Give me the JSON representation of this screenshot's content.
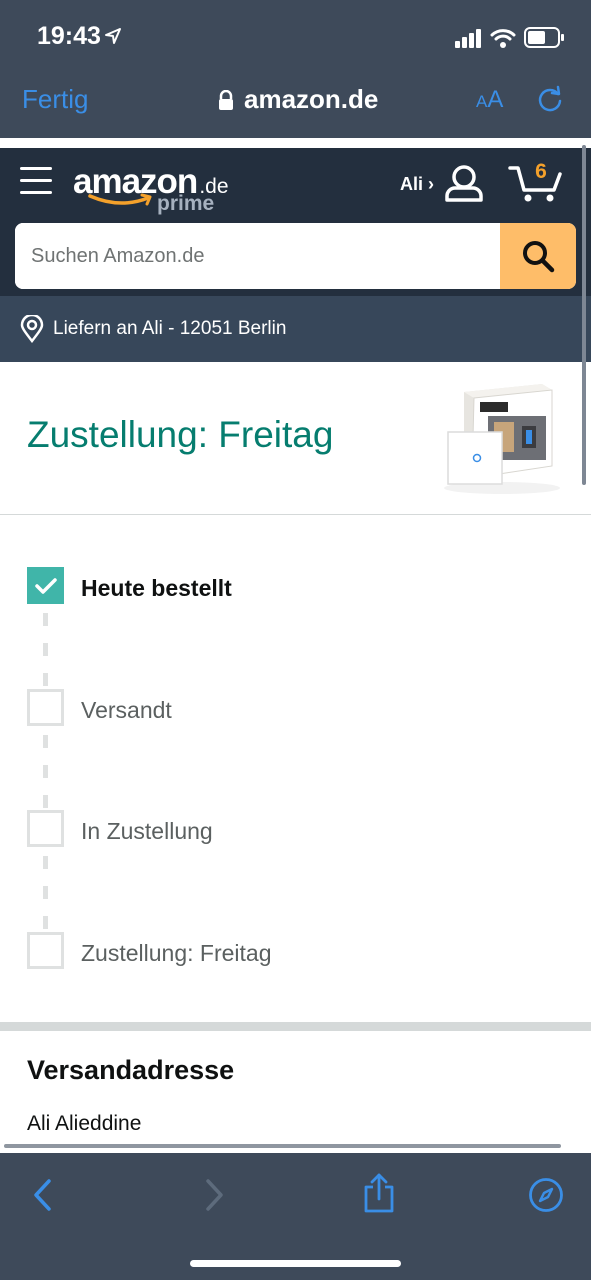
{
  "status_bar": {
    "time": "19:43"
  },
  "browser": {
    "done_label": "Fertig",
    "domain": "amazon.de",
    "text_size_small": "A",
    "text_size_large": "A"
  },
  "header": {
    "logo_main": "amazon",
    "logo_tld": ".de",
    "logo_sub": "prime",
    "account_label": "Ali ›",
    "cart_count": "6",
    "colors": {
      "header_bg": "#232f3e",
      "accent": "#febd69",
      "cart": "#f4a12b"
    }
  },
  "search": {
    "placeholder": "Suchen Amazon.de"
  },
  "delivery_location": {
    "text": "Liefern an Ali - 12051 Berlin"
  },
  "order": {
    "title": "Zustellung: Freitag",
    "steps": [
      {
        "label": "Heute bestellt",
        "done": true
      },
      {
        "label": "Versandt",
        "done": false
      },
      {
        "label": "In Zustellung",
        "done": false
      },
      {
        "label": "Zustellung: Freitag",
        "done": false
      }
    ],
    "step_color": "#40b5a9",
    "title_color": "#067d6f"
  },
  "address": {
    "title": "Versandadresse",
    "name": "Ali Alieddine"
  },
  "toolbar": {
    "icons": [
      "chevron-left-icon",
      "chevron-right-icon",
      "share-icon",
      "compass-icon"
    ]
  }
}
